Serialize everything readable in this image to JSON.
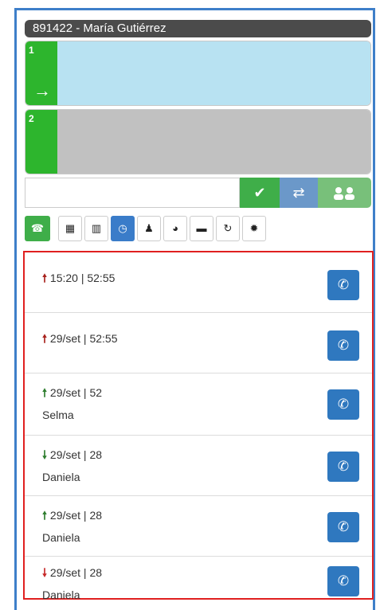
{
  "title": "891422 - María Gutiérrez",
  "lines": [
    {
      "num": "1",
      "arrow": "→"
    },
    {
      "num": "2",
      "arrow": ""
    }
  ],
  "dialer": {
    "value": "",
    "placeholder": ""
  },
  "colors": {
    "green": "#3fae49",
    "blue": "#2f78bf",
    "frame": "#3e7fc9",
    "highlight": "#e02020"
  },
  "toolbar_icons": [
    "phone-icon",
    "dialpad-icon",
    "panel-icon",
    "clock-icon",
    "user-icon",
    "globe-icon",
    "chat-icon",
    "refresh-icon",
    "settings-icon"
  ],
  "history": [
    {
      "direction": "up",
      "color": "red",
      "arrow": "🠕",
      "time": "15:20 | 52:55",
      "name": ""
    },
    {
      "direction": "up",
      "color": "red",
      "arrow": "🠕",
      "time": "29/set | 52:55",
      "name": ""
    },
    {
      "direction": "up",
      "color": "green",
      "arrow": "🠕",
      "time": "29/set | 52",
      "name": "Selma"
    },
    {
      "direction": "down",
      "color": "green",
      "arrow": "🠗",
      "time": "29/set | 28",
      "name": "Daniela"
    },
    {
      "direction": "up",
      "color": "green",
      "arrow": "🠕",
      "time": "29/set | 28",
      "name": "Daniela"
    },
    {
      "direction": "down",
      "color": "red",
      "arrow": "🠗",
      "time": "29/set | 28",
      "name": "Daniela"
    }
  ]
}
